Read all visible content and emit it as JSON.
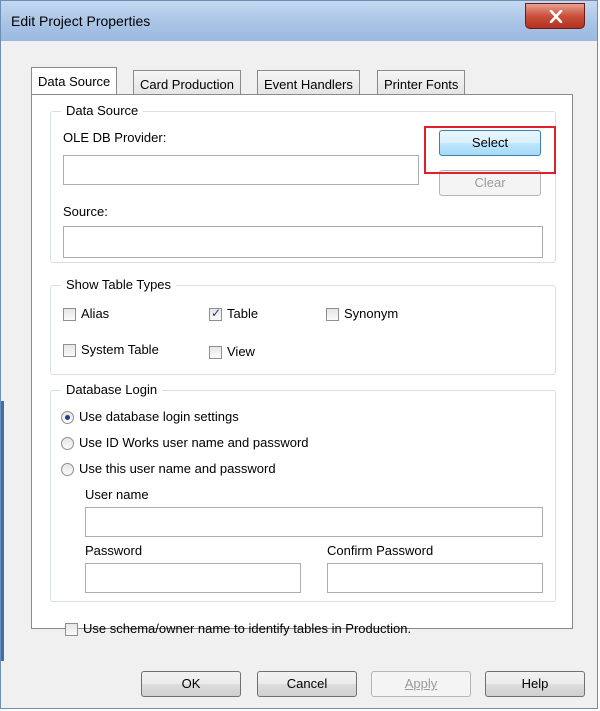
{
  "window": {
    "title": "Edit Project Properties"
  },
  "tabs": [
    {
      "label": "Data Source",
      "active": true
    },
    {
      "label": "Card Production",
      "active": false
    },
    {
      "label": "Event Handlers",
      "active": false
    },
    {
      "label": "Printer Fonts",
      "active": false
    }
  ],
  "data_source": {
    "group_label": "Data Source",
    "provider_label": "OLE DB Provider:",
    "provider_value": "",
    "select_label": "Select",
    "clear_label": "Clear",
    "source_label": "Source:",
    "source_value": ""
  },
  "table_types": {
    "group_label": "Show Table Types",
    "alias": {
      "label": "Alias",
      "checked": false
    },
    "table": {
      "label": "Table",
      "checked": true
    },
    "synonym": {
      "label": "Synonym",
      "checked": false
    },
    "system_table": {
      "label": "System Table",
      "checked": false
    },
    "view": {
      "label": "View",
      "checked": false
    }
  },
  "login": {
    "group_label": "Database Login",
    "option_db": "Use database login settings",
    "option_idworks": "Use ID Works user name and password",
    "option_this": "Use this user name and password",
    "selected": "option_db",
    "username_label": "User name",
    "username_value": "",
    "password_label": "Password",
    "password_value": "",
    "confirm_label": "Confirm Password",
    "confirm_value": ""
  },
  "schema_option": {
    "label": "Use schema/owner name to identify tables in Production.",
    "checked": false
  },
  "footer": {
    "ok": "OK",
    "cancel": "Cancel",
    "apply": "Apply",
    "help": "Help"
  },
  "colors": {
    "highlight": "#e0202a",
    "title_bar": "#a9c4e6",
    "close_button": "#c9503b"
  }
}
